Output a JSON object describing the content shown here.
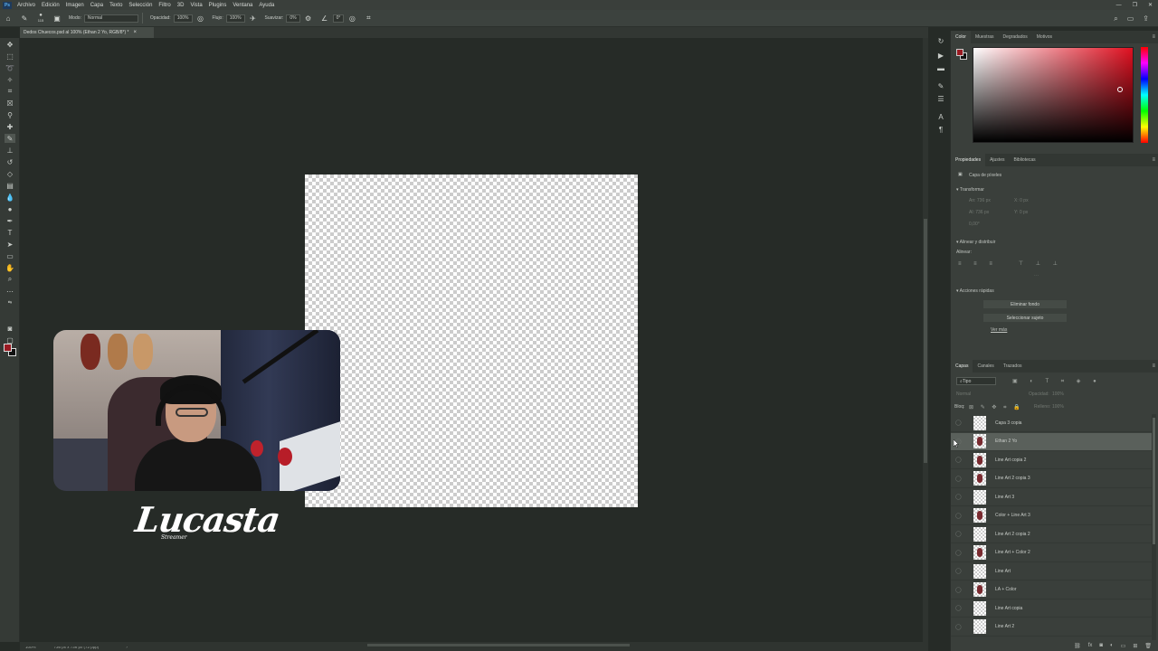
{
  "app": {
    "logo": "Ps"
  },
  "menu": [
    "Archivo",
    "Edición",
    "Imagen",
    "Capa",
    "Texto",
    "Selección",
    "Filtro",
    "3D",
    "Vista",
    "Plugins",
    "Ventana",
    "Ayuda"
  ],
  "window_controls": [
    "—",
    "❐",
    "✕"
  ],
  "options_bar": {
    "brush_size": "115",
    "mode_label": "Modo:",
    "mode_value": "Normal",
    "opacity_label": "Opacidad:",
    "opacity_value": "100%",
    "flow_label": "Flujo:",
    "flow_value": "100%",
    "smoothing_label": "Suavizar:",
    "smoothing_value": "0%",
    "angle_value": "0°"
  },
  "document": {
    "tab_title": "Dedos Chuecos.psd al 100% (Ethan 2 Yo, RGB/8*) *",
    "close": "×"
  },
  "brand": {
    "name": "Lucasta",
    "sub": "Streamer"
  },
  "color_panel": {
    "tabs": [
      "Color",
      "Muestras",
      "Degradados",
      "Motivos"
    ],
    "foreground": "#9a1a22",
    "background": "#111111"
  },
  "properties_panel": {
    "tabs": [
      "Propiedades",
      "Ajustes",
      "Bibliotecas"
    ],
    "layer_type": "Capa de píxeles",
    "transform_header": "Transformar",
    "transform_fields": [
      "An: 736 px",
      "Al: 736 px",
      "X: 0 px",
      "Y: 0 px",
      "0,00°"
    ],
    "align_header": "Alinear y distribuir",
    "align_label": "Alinear:",
    "quick_actions_header": "Acciones rápidas",
    "btn_remove_bg": "Eliminar fondo",
    "btn_select_subject": "Seleccionar sujeto",
    "more_link": "Ver más"
  },
  "layers_panel": {
    "tabs": [
      "Capas",
      "Canales",
      "Trazados"
    ],
    "filter_label": "Tipo",
    "blend_mode": "Normal",
    "opacity_label": "Opacidad:",
    "opacity_value": "100%",
    "lock_label": "Bloq:",
    "fill_label": "Relleno:",
    "fill_value": "100%",
    "layers": [
      {
        "name": "Capa 3 copia",
        "selected": false,
        "figure": false
      },
      {
        "name": "Ethan 2 Yo",
        "selected": true,
        "figure": true
      },
      {
        "name": "Line Art copia 2",
        "selected": false,
        "figure": true
      },
      {
        "name": "Line Art 2 copia 3",
        "selected": false,
        "figure": true
      },
      {
        "name": "Line Art 3",
        "selected": false,
        "figure": false
      },
      {
        "name": "Color + Line Art 3",
        "selected": false,
        "figure": true
      },
      {
        "name": "Line Art 2 copia 2",
        "selected": false,
        "figure": false
      },
      {
        "name": "Line Art + Color 2",
        "selected": false,
        "figure": true
      },
      {
        "name": "Line Art",
        "selected": false,
        "figure": false
      },
      {
        "name": "LA + Color",
        "selected": false,
        "figure": true
      },
      {
        "name": "Line Art copia",
        "selected": false,
        "figure": false
      },
      {
        "name": "Line Art 2",
        "selected": false,
        "figure": false
      }
    ]
  },
  "status": {
    "zoom": "100%",
    "doc_info": "736 px x 736 px (72 ppp)"
  }
}
